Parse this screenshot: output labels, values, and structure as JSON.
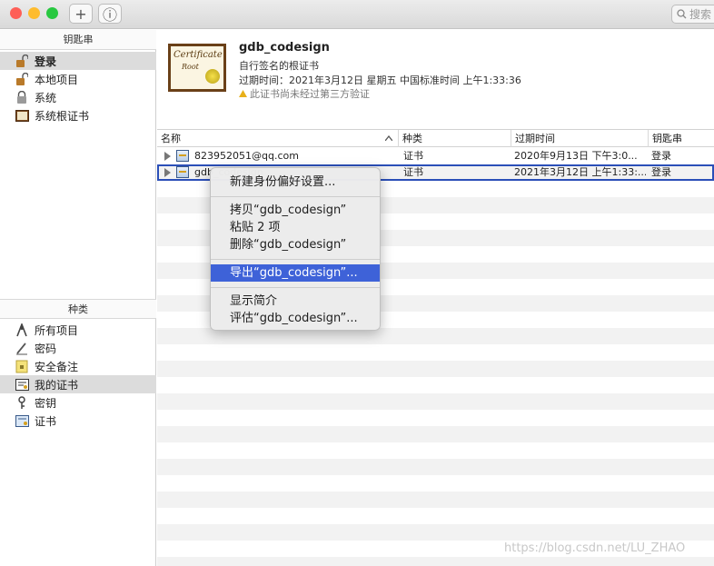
{
  "toolbar": {
    "add_symbol": "+",
    "info_symbol": "ⓘ",
    "search_placeholder": "搜索"
  },
  "sidebar": {
    "keychains_header": "钥匙串",
    "keychains": [
      {
        "label": "登录",
        "icon": "unlocked-padlock-icon",
        "selected": true
      },
      {
        "label": "本地项目",
        "icon": "unlocked-padlock-icon",
        "selected": false
      },
      {
        "label": "系统",
        "icon": "locked-padlock-icon",
        "selected": false
      },
      {
        "label": "系统根证书",
        "icon": "cabinet-icon",
        "selected": false
      }
    ],
    "category_header": "种类",
    "categories": [
      {
        "label": "所有项目",
        "icon": "all-items-icon",
        "selected": false
      },
      {
        "label": "密码",
        "icon": "password-pen-icon",
        "selected": false
      },
      {
        "label": "安全备注",
        "icon": "secure-note-icon",
        "selected": false
      },
      {
        "label": "我的证书",
        "icon": "my-certificate-icon",
        "selected": true
      },
      {
        "label": "密钥",
        "icon": "key-icon",
        "selected": false
      },
      {
        "label": "证书",
        "icon": "certificate-icon",
        "selected": false
      }
    ]
  },
  "detail": {
    "cert_image_title": "Certificate",
    "cert_image_subtitle": "Root",
    "name": "gdb_codesign",
    "type_line": "自行签名的根证书",
    "expiry_line": "过期时间：2021年3月12日 星期五 中国标准时间 上午1:33:36",
    "warning_line": "此证书尚未经过第三方验证"
  },
  "table": {
    "columns": [
      "名称",
      "种类",
      "过期时间",
      "钥匙串"
    ],
    "rows": [
      {
        "name": "823952051@qq.com",
        "kind": "证书",
        "expires": "2020年9月13日 下午3:0...",
        "keychain": "登录"
      },
      {
        "name": "gdb_codesign",
        "kind": "证书",
        "expires": "2021年3月12日 上午1:33:...",
        "keychain": "登录"
      }
    ]
  },
  "context_menu": {
    "items": [
      {
        "label": "新建身份偏好设置...",
        "highlighted": false
      },
      {
        "label": "拷贝“gdb_codesign”",
        "highlighted": false
      },
      {
        "label": "粘贴 2 项",
        "highlighted": false
      },
      {
        "label": "删除“gdb_codesign”",
        "highlighted": false
      },
      {
        "label": "导出“gdb_codesign”...",
        "highlighted": true
      },
      {
        "label": "显示简介",
        "highlighted": false
      },
      {
        "label": "评估“gdb_codesign”...",
        "highlighted": false
      }
    ]
  },
  "watermark": "https://blog.csdn.net/LU_ZHAO",
  "colors": {
    "highlight": "#3e62d8",
    "close": "#fe5f57",
    "minimize": "#febc2e",
    "zoom": "#28c840"
  }
}
